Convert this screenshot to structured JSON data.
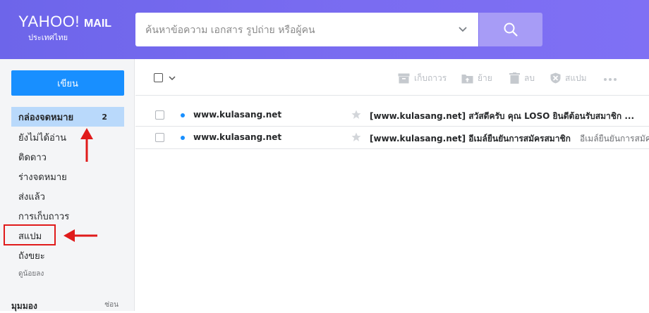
{
  "header": {
    "brand": "YAHOO!",
    "product": "MAIL",
    "region": "ประเทศไทย",
    "search_placeholder": "ค้นหาข้อความ เอกสาร รูปถ่าย หรือผู้คน"
  },
  "sidebar": {
    "compose_label": "เขียน",
    "folders": [
      {
        "label": "กล่องจดหมาย",
        "count": "2"
      },
      {
        "label": "ยังไม่ได้อ่าน"
      },
      {
        "label": "ติดดาว"
      },
      {
        "label": "ร่างจดหมาย"
      },
      {
        "label": "ส่งแล้ว"
      },
      {
        "label": "การเก็บถาวร"
      },
      {
        "label": "สแปม"
      },
      {
        "label": "ถังขยะ"
      },
      {
        "label": "ดูน้อยลง"
      }
    ],
    "views_label": "มุมมอง",
    "views_hide": "ซ่อน"
  },
  "toolbar": {
    "archive": "เก็บถาวร",
    "move": "ย้าย",
    "delete": "ลบ",
    "spam": "สแปม"
  },
  "messages": [
    {
      "sender": "www.kulasang.net",
      "subject": "[www.kulasang.net] สวัสดีครับ คุณ LOSO ยินดีต้อนรับสมาชิก ...",
      "snippet": ""
    },
    {
      "sender": "www.kulasang.net",
      "subject": "[www.kulasang.net] อีเมล์ยืนยันการสมัครสมาชิก",
      "snippet": "อีเมล์ยืนยันการสมัค"
    }
  ],
  "colors": {
    "header": "#7a6cf1",
    "compose": "#188fff",
    "active_folder": "#b9d9fb",
    "annotation": "#e01b1b"
  }
}
